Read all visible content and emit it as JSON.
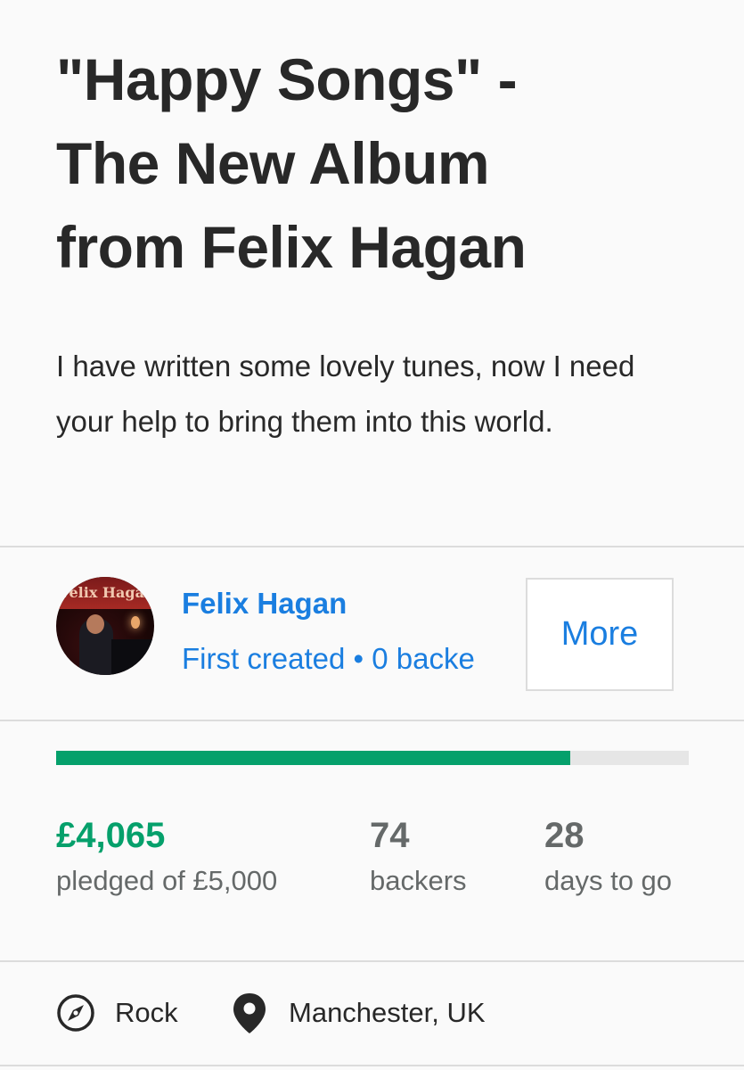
{
  "project": {
    "title": "\"Happy Songs\" -\nThe New Album\nfrom Felix Hagan",
    "blurb": "I have written some lovely tunes, now I need your help to bring them into this world."
  },
  "creator": {
    "avatar_text": "Felix Hagan",
    "name": "Felix Hagan",
    "meta": "First created • 0 backe",
    "more_label": "More"
  },
  "funding": {
    "progress_fraction": 0.813,
    "pledged": "£4,065",
    "pledged_label": "pledged of £5,000",
    "backers": "74",
    "backers_label": "backers",
    "days": "28",
    "days_label": "days to go"
  },
  "tags": {
    "category": "Rock",
    "category_icon": "compass-icon",
    "location": "Manchester, UK",
    "location_icon": "location-pin-icon"
  },
  "colors": {
    "accent_green": "#05a06b",
    "link_blue": "#1a7ee0"
  }
}
